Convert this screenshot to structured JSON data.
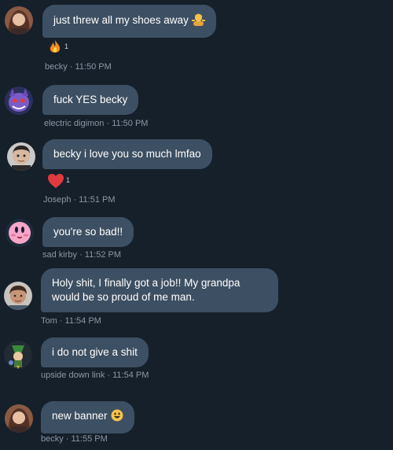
{
  "messages": [
    {
      "author": "becky",
      "text": "just threw all my shoes away",
      "emoji": "person-shrugging",
      "meta": "becky · 11:50 PM",
      "reaction": {
        "icon": "fire",
        "count": "1"
      }
    },
    {
      "author": "electric digimon",
      "text": "fuck YES becky",
      "meta": "electric digimon · 11:50 PM"
    },
    {
      "author": "Joseph",
      "text": "becky i love you so much lmfao",
      "meta": "Joseph  · 11:51 PM",
      "reaction": {
        "icon": "red-heart",
        "count": "1"
      }
    },
    {
      "author": "sad kirby",
      "text": "you're so bad!!",
      "meta": "sad kirby · 11:52 PM"
    },
    {
      "author": "Tom",
      "text": "Holy shit, I finally got a job!! My grandpa would be so proud of me man.",
      "meta": "Tom · 11:54 PM"
    },
    {
      "author": "upside down link",
      "text": "i do not give a shit",
      "meta": "upside down link · 11:54 PM"
    },
    {
      "author": "becky",
      "text": "new banner",
      "emoji": "grinning-face",
      "meta": "becky · 11:55 PM"
    }
  ],
  "colors": {
    "background": "#15202b",
    "bubble": "#3d4f62",
    "meta": "#8b98a5"
  }
}
